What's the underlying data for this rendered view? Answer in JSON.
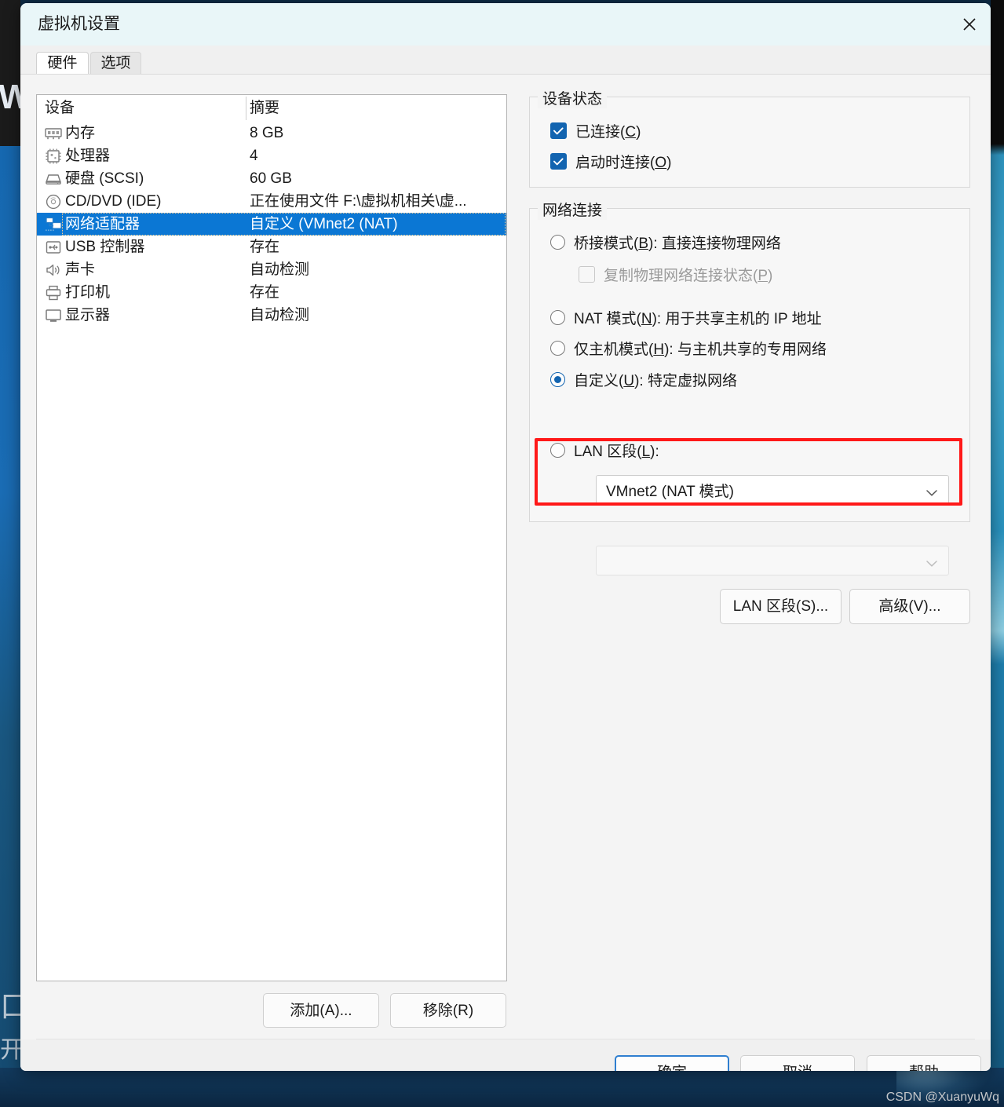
{
  "window": {
    "title": "虚拟机设置",
    "close_icon": "close-icon"
  },
  "tabs": [
    {
      "label": "硬件",
      "active": true
    },
    {
      "label": "选项",
      "active": false
    }
  ],
  "device_table": {
    "columns": [
      "设备",
      "摘要"
    ],
    "rows": [
      {
        "icon": "memory-icon",
        "name": "内存",
        "summary": "8 GB",
        "selected": false
      },
      {
        "icon": "processor-icon",
        "name": "处理器",
        "summary": "4",
        "selected": false
      },
      {
        "icon": "harddisk-icon",
        "name": "硬盘 (SCSI)",
        "summary": "60 GB",
        "selected": false
      },
      {
        "icon": "cddvd-icon",
        "name": "CD/DVD (IDE)",
        "summary": "正在使用文件 F:\\虚拟机相关\\虚...",
        "selected": false
      },
      {
        "icon": "network-icon",
        "name": "网络适配器",
        "summary": "自定义 (VMnet2 (NAT)",
        "selected": true
      },
      {
        "icon": "usb-icon",
        "name": "USB 控制器",
        "summary": "存在",
        "selected": false
      },
      {
        "icon": "sound-icon",
        "name": "声卡",
        "summary": "自动检测",
        "selected": false
      },
      {
        "icon": "printer-icon",
        "name": "打印机",
        "summary": "存在",
        "selected": false
      },
      {
        "icon": "display-icon",
        "name": "显示器",
        "summary": "自动检测",
        "selected": false
      }
    ]
  },
  "list_buttons": {
    "add": "添加(A)...",
    "remove": "移除(R)"
  },
  "device_status": {
    "title": "设备状态",
    "items": [
      {
        "label_pre": "已连接(",
        "accel": "C",
        "label_post": ")",
        "checked": true,
        "disabled": false
      },
      {
        "label_pre": "启动时连接(",
        "accel": "O",
        "label_post": ")",
        "checked": true,
        "disabled": false
      }
    ]
  },
  "network_connection": {
    "title": "网络连接",
    "options": [
      {
        "label_pre": "桥接模式(",
        "accel": "B",
        "label_post": "): 直接连接物理网络",
        "selected": false
      },
      {
        "label_pre": "NAT 模式(",
        "accel": "N",
        "label_post": "): 用于共享主机的 IP 地址",
        "selected": false
      },
      {
        "label_pre": "仅主机模式(",
        "accel": "H",
        "label_post": "): 与主机共享的专用网络",
        "selected": false
      },
      {
        "label_pre": "自定义(",
        "accel": "U",
        "label_post": "): 特定虚拟网络",
        "selected": true
      },
      {
        "label_pre": "LAN 区段(",
        "accel": "L",
        "label_post": "):",
        "selected": false
      }
    ],
    "replicate_checkbox": {
      "label_pre": "复制物理网络连接状态(",
      "accel": "P",
      "label_post": ")",
      "checked": false,
      "disabled": true
    },
    "custom_combo_value": "VMnet2 (NAT 模式)",
    "lan_combo_value": "",
    "highlight_color": "#ff1919"
  },
  "side_buttons": {
    "lan_segment": "LAN 区段(S)...",
    "advanced": "高级(V)..."
  },
  "footer_buttons": {
    "ok": "确定",
    "cancel": "取消",
    "help": "帮助"
  },
  "watermark": "CSDN @XuanyuWq",
  "backdrop": {
    "left_letter": "W",
    "left_glyph1": "口",
    "left_glyph2": "开"
  },
  "colors": {
    "selection_blue": "#0b77d4",
    "checkbox_blue": "#1264b0",
    "highlight_red": "#ff1919",
    "titlebar": "#e9f6f8"
  }
}
